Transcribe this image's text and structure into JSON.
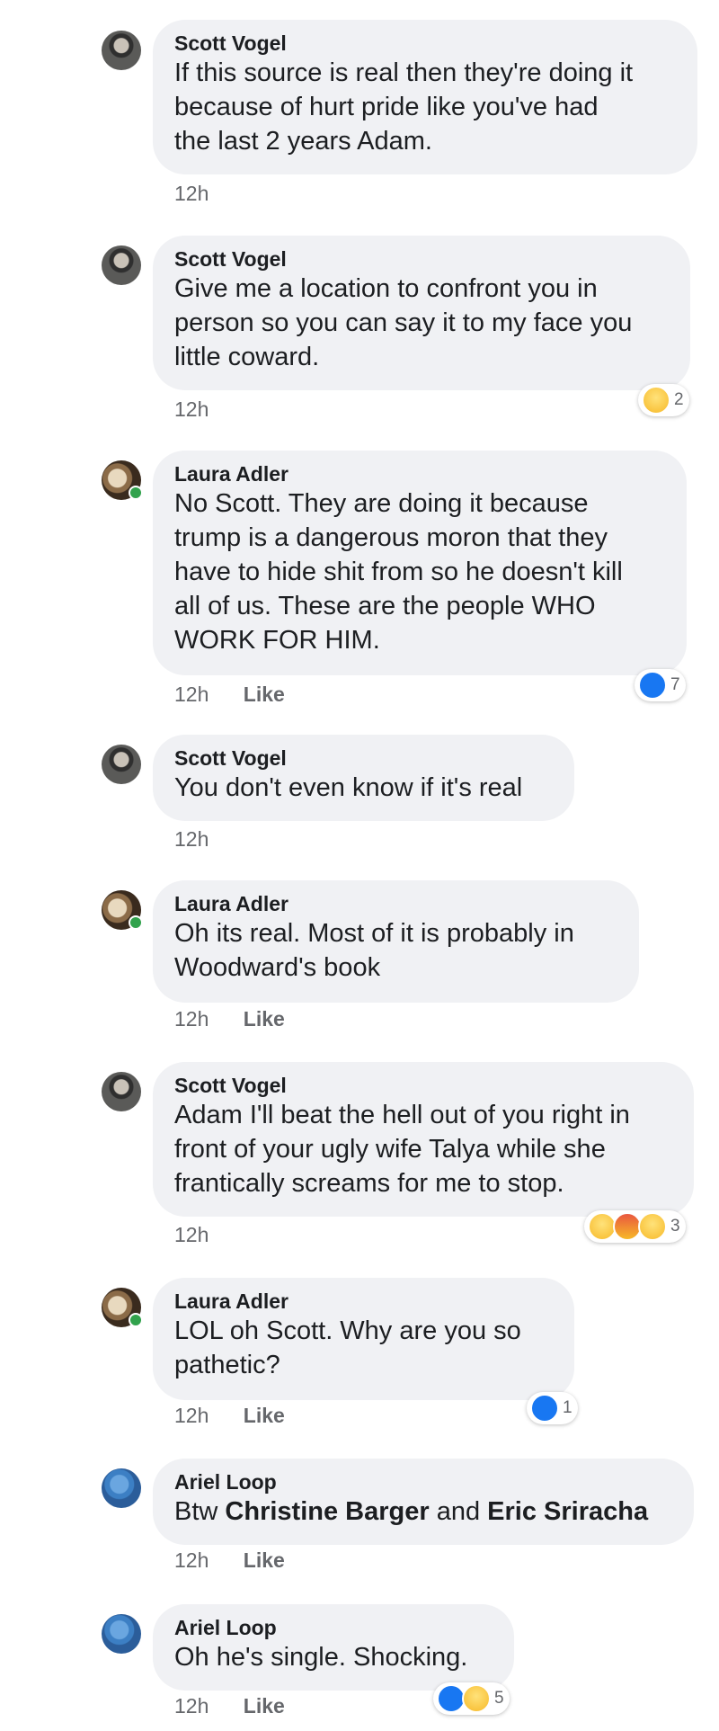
{
  "comments": [
    {
      "author": "Scott Vogel",
      "lines": [
        "If this source is real then they're doing it",
        "because of hurt pride like you've had",
        "the last 2 years Adam."
      ],
      "time": "12h"
    },
    {
      "author": "Scott Vogel",
      "lines": [
        "Give me a location to confront you in",
        "person so you can say it to my face you",
        "little coward."
      ],
      "time": "12h",
      "reaction_count": "2"
    },
    {
      "author": "Laura Adler",
      "lines": [
        "No Scott.  They are doing it because",
        "trump is a dangerous moron that they",
        "have to hide shit from so he doesn't kill",
        "all of us.  These are the people WHO",
        "WORK FOR HIM."
      ],
      "time": "12h",
      "like_label": "Like",
      "reaction_count": "7"
    },
    {
      "author": "Scott Vogel",
      "lines": [
        "You don't even know if it's real"
      ],
      "time": "12h"
    },
    {
      "author": "Laura Adler",
      "lines": [
        "Oh its real.  Most of it is probably in",
        "Woodward's book"
      ],
      "time": "12h",
      "like_label": "Like"
    },
    {
      "author": "Scott Vogel",
      "lines": [
        "Adam I'll beat the hell out of you right in",
        "front of your ugly wife Talya while she",
        "frantically screams for me to stop."
      ],
      "time": "12h",
      "reaction_count": "3"
    },
    {
      "author": "Laura Adler",
      "lines": [
        "LOL oh Scott.  Why are you so",
        "pathetic?"
      ],
      "time": "12h",
      "like_label": "Like",
      "reaction_count": "1"
    },
    {
      "author": "Ariel Loop",
      "text_prefix": "Btw ",
      "mention_1": "Christine Barger",
      "text_mid": " and ",
      "mention_2": "Eric Sriracha",
      "time": "12h",
      "like_label": "Like"
    },
    {
      "author": "Ariel Loop",
      "lines": [
        "Oh he's single. Shocking."
      ],
      "time": "12h",
      "like_label": "Like",
      "reaction_count": "5"
    }
  ],
  "colors": {
    "bubble": "#f0f1f4",
    "meta": "#65676b",
    "like_blue": "#1877f2",
    "online_green": "#31a24c"
  }
}
